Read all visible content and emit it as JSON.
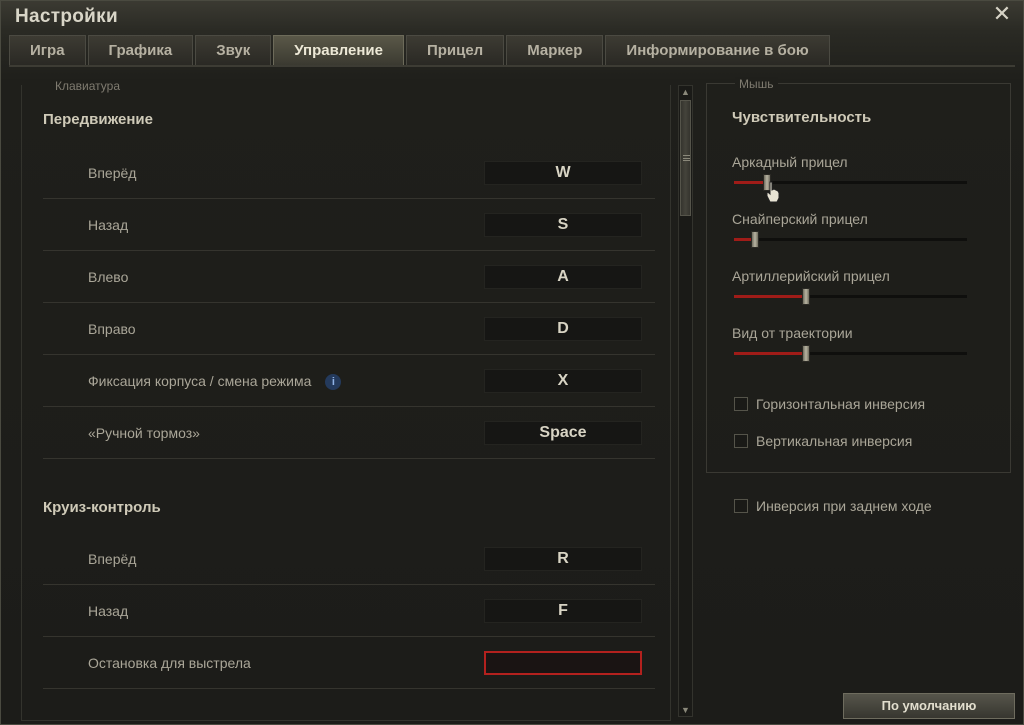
{
  "window": {
    "title": "Настройки",
    "close_icon": "close-icon"
  },
  "tabs": [
    {
      "label": "Игра",
      "active": false
    },
    {
      "label": "Графика",
      "active": false
    },
    {
      "label": "Звук",
      "active": false
    },
    {
      "label": "Управление",
      "active": true
    },
    {
      "label": "Прицел",
      "active": false
    },
    {
      "label": "Маркер",
      "active": false
    },
    {
      "label": "Информирование в бою",
      "active": false
    }
  ],
  "keyboard": {
    "legend": "Клавиатура",
    "movement": {
      "title": "Передвижение",
      "rows": [
        {
          "label": "Вперёд",
          "key": "W"
        },
        {
          "label": "Назад",
          "key": "S"
        },
        {
          "label": "Влево",
          "key": "A"
        },
        {
          "label": "Вправо",
          "key": "D"
        },
        {
          "label": "Фиксация корпуса / смена режима",
          "key": "X",
          "info_icon": "info-icon"
        },
        {
          "label": "«Ручной тормоз»",
          "key": "Space"
        }
      ]
    },
    "cruise": {
      "title": "Круиз-контроль",
      "rows": [
        {
          "label": "Вперёд",
          "key": "R"
        },
        {
          "label": "Назад",
          "key": "F"
        },
        {
          "label": "Остановка для выстрела",
          "key": ""
        }
      ]
    },
    "info_icon_glyph": "i"
  },
  "mouse": {
    "legend": "Мышь",
    "sensitivity_title": "Чувствительность",
    "sliders": [
      {
        "label": "Аркадный прицел",
        "value": 0.14
      },
      {
        "label": "Снайперский прицел",
        "value": 0.09
      },
      {
        "label": "Артиллерийский прицел",
        "value": 0.31
      },
      {
        "label": "Вид от траектории",
        "value": 0.31
      }
    ],
    "checkboxes": [
      {
        "label": "Горизонтальная инверсия",
        "checked": false
      },
      {
        "label": "Вертикальная инверсия",
        "checked": false
      }
    ],
    "reverse_checkbox": {
      "label": "Инверсия при заднем ходе",
      "checked": false
    }
  },
  "buttons": {
    "default_label": "По умолчанию"
  },
  "colors": {
    "accent_red": "#b3211e",
    "slider_fill": "#a01c18",
    "active_tab": "#5a5848"
  }
}
